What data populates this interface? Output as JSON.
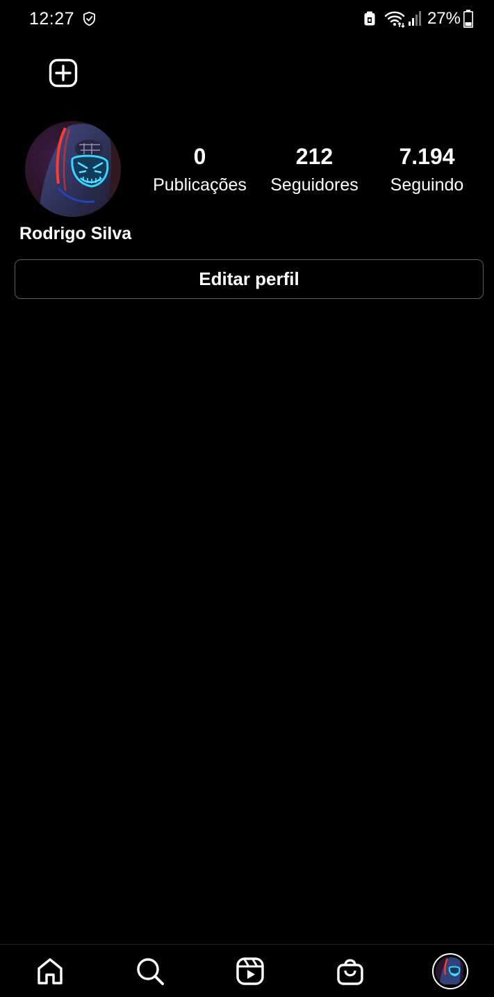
{
  "status_bar": {
    "time": "12:27",
    "battery": "27%",
    "icons": [
      "shield-check-icon",
      "nfc-icon",
      "wifi-icon",
      "signal-icon",
      "battery-icon"
    ]
  },
  "header": {
    "create_icon": "plus-square-icon"
  },
  "profile": {
    "name": "Rodrigo Silva",
    "avatar_icon": "avatar-neon-mask",
    "stats": [
      {
        "value": "0",
        "label": "Publicações"
      },
      {
        "value": "212",
        "label": "Seguidores"
      },
      {
        "value": "7.194",
        "label": "Seguindo"
      }
    ],
    "edit_label": "Editar perfil"
  },
  "bottom_nav": {
    "items": [
      "home-icon",
      "search-icon",
      "reels-icon",
      "shop-icon",
      "profile-avatar"
    ]
  },
  "colors": {
    "background": "#000000",
    "text": "#ffffff",
    "button_border": "#5c5c5c"
  }
}
